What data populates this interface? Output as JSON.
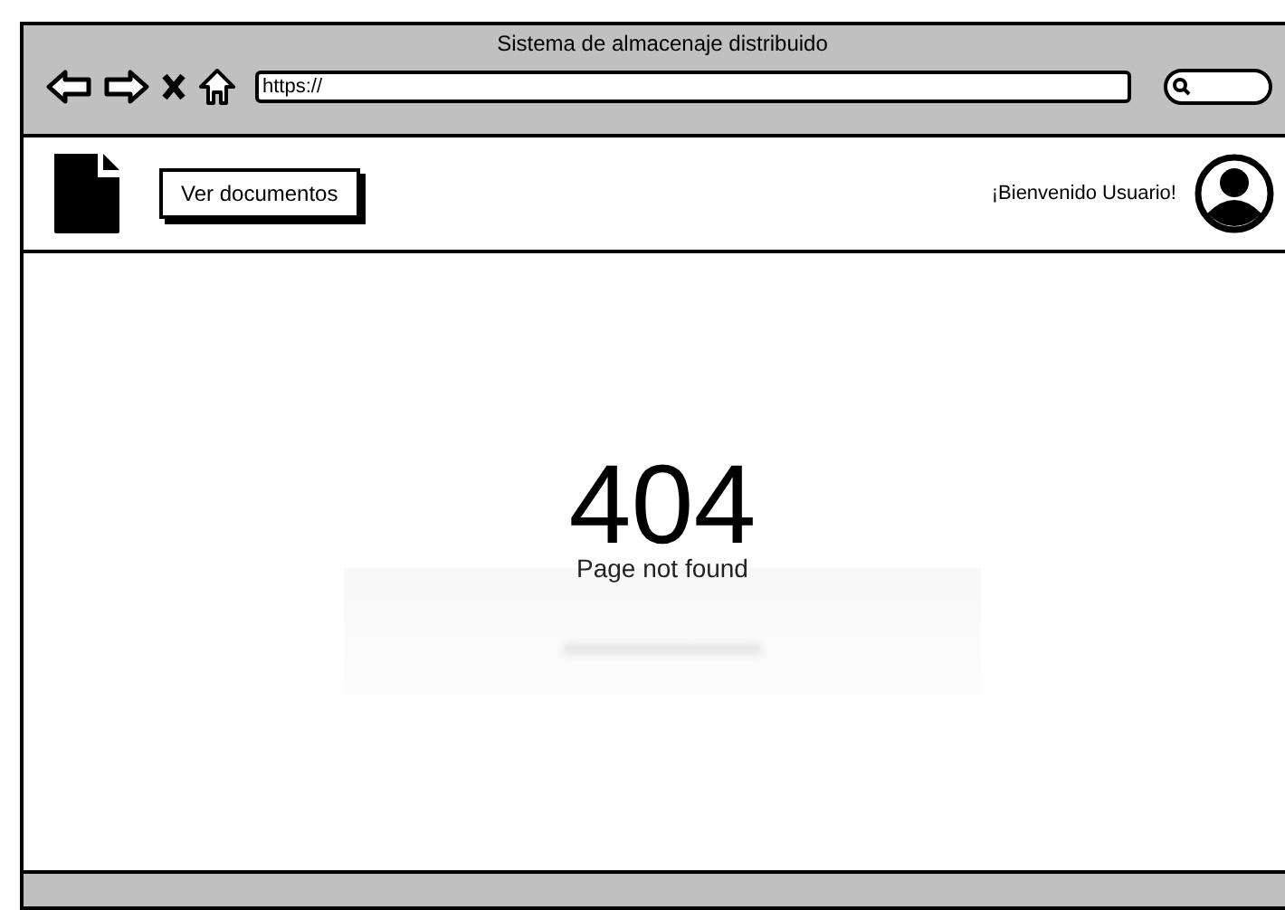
{
  "window": {
    "title": "Sistema de almacenaje distribuido"
  },
  "address_bar": {
    "value": "https://"
  },
  "header": {
    "button": "Ver documentos",
    "welcome": "¡Bienvenido Usuario!"
  },
  "error": {
    "code": "404",
    "message": "Page not found"
  }
}
